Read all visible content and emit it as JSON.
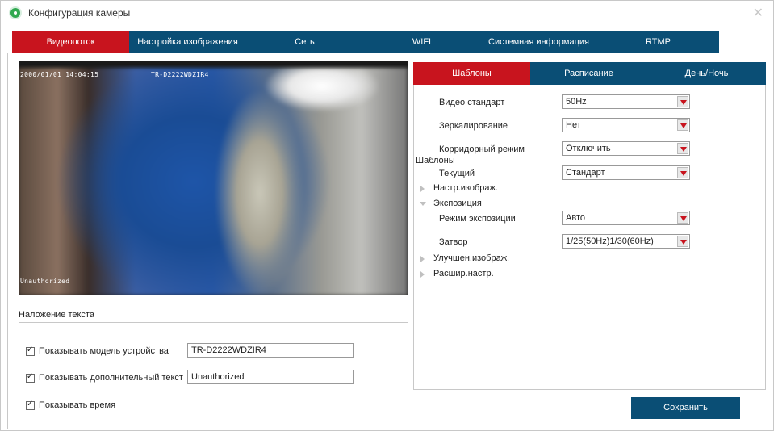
{
  "window": {
    "title": "Конфигурация камеры",
    "close_glyph": "✕"
  },
  "main_tabs": [
    {
      "label": "Видеопоток",
      "active": true
    },
    {
      "label": "Настройка изображения",
      "active": false
    },
    {
      "label": "Сеть",
      "active": false
    },
    {
      "label": "WIFI",
      "active": false
    },
    {
      "label": "Системная информация",
      "active": false
    },
    {
      "label": "RTMP",
      "active": false
    }
  ],
  "video": {
    "timestamp": "2000/01/01 14:04:15",
    "model_osd": "TR-D2222WDZIR4",
    "extra_osd": "Unauthorized"
  },
  "overlay": {
    "section_title": "Наложение текста",
    "show_model_label": "Показывать модель устройства",
    "show_model_value": "TR-D2222WDZIR4",
    "show_extra_label": "Показывать дополнительный текст",
    "show_extra_value": "Unauthorized",
    "show_time_label": "Показывать время"
  },
  "panel_tabs": [
    {
      "label": "Шаблоны",
      "active": true
    },
    {
      "label": "Расписание",
      "active": false
    },
    {
      "label": "День/Ночь",
      "active": false
    }
  ],
  "settings": {
    "video_standard_label": "Видео стандарт",
    "video_standard_value": "50Hz",
    "mirror_label": "Зеркалирование",
    "mirror_value": "Нет",
    "corridor_label": "Корридорный режим",
    "corridor_value": "Отключить",
    "templates_label": "Шаблоны",
    "current_label": "Текущий",
    "current_value": "Стандарт",
    "image_settings_label": "Настр.изображ.",
    "exposure_label": "Экспозиция",
    "exposure_mode_label": "Режим экспозиции",
    "exposure_mode_value": "Авто",
    "shutter_label": "Затвор",
    "shutter_value": "1/25(50Hz)1/30(60Hz)",
    "enhance_label": "Улучшен.изображ.",
    "advanced_label": "Расшир.настр."
  },
  "save_label": "Сохранить",
  "colors": {
    "accent_red": "#c8141e",
    "nav_blue": "#0a4e75"
  }
}
